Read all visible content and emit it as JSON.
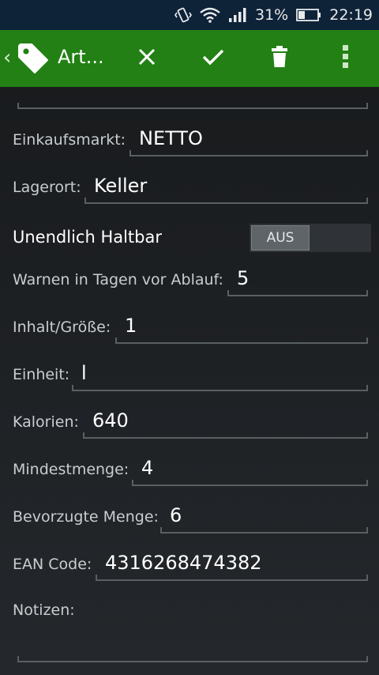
{
  "status_bar": {
    "battery": "31%",
    "time": "22:19",
    "icons": [
      "vibrate-icon",
      "wifi-icon",
      "signal-icon",
      "battery-icon"
    ]
  },
  "action_bar": {
    "title": "Art...",
    "color": "#228014",
    "icons": [
      "back-chevron-icon",
      "tag-icon",
      "close-icon",
      "check-icon",
      "delete-icon",
      "overflow-menu-icon"
    ]
  },
  "form": {
    "einkaufsmarkt": {
      "label": "Einkaufsmarkt:",
      "value": "NETTO"
    },
    "lagerort": {
      "label": "Lagerort:",
      "value": "Keller"
    },
    "unendlich": {
      "label": "Unendlich Haltbar",
      "state": "AUS"
    },
    "warnen": {
      "label": "Warnen in Tagen vor Ablauf:",
      "value": "5"
    },
    "inhalt": {
      "label": "Inhalt/Größe:",
      "value": "1"
    },
    "einheit": {
      "label": "Einheit:",
      "value": "l"
    },
    "kalorien": {
      "label": "Kalorien:",
      "value": "640"
    },
    "mindestmenge": {
      "label": "Mindestmenge:",
      "value": "4"
    },
    "bevorzugte": {
      "label": "Bevorzugte Menge:",
      "value": "6"
    },
    "ean": {
      "label": "EAN Code:",
      "value": "4316268474382"
    },
    "notizen": {
      "label": "Notizen:",
      "value": ""
    }
  }
}
